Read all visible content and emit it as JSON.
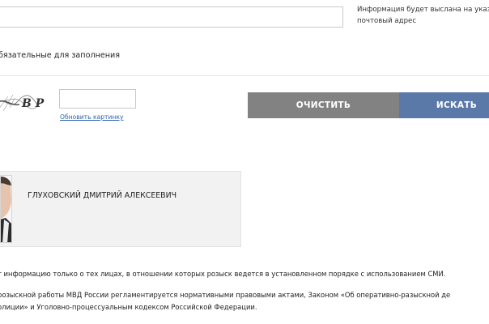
{
  "form": {
    "email_value": "",
    "email_hint_line1": "Информация будет выслана на указа",
    "email_hint_line2": "почтовый адрес",
    "required_note": "бязательные для заполнения",
    "captcha_value": "",
    "captcha_text": "B P",
    "refresh_link": "Обновить картинку",
    "clear_button": "ОЧИСТИТЬ",
    "search_button": "ИСКАТЬ"
  },
  "results": [
    {
      "name": "ГЛУХОВСКИЙ ДМИТРИЙ АЛЕКСЕЕВИЧ"
    }
  ],
  "notes": {
    "line1": "т информацию только о тех лицах, в отношении которых розыск ведется в установленном порядке с использованием СМИ.",
    "line2": "розыскной работы МВД России регламентируется нормативными правовыми актами, Законом «Об оперативно-разыскной де",
    "line3": "олиции» и Уголовно-процессуальным кодексом Российской Федерации."
  },
  "colors": {
    "clear_button": "#828282",
    "search_button": "#5a78a8",
    "link": "#2a61b3",
    "card_background": "#f2f2f2"
  }
}
